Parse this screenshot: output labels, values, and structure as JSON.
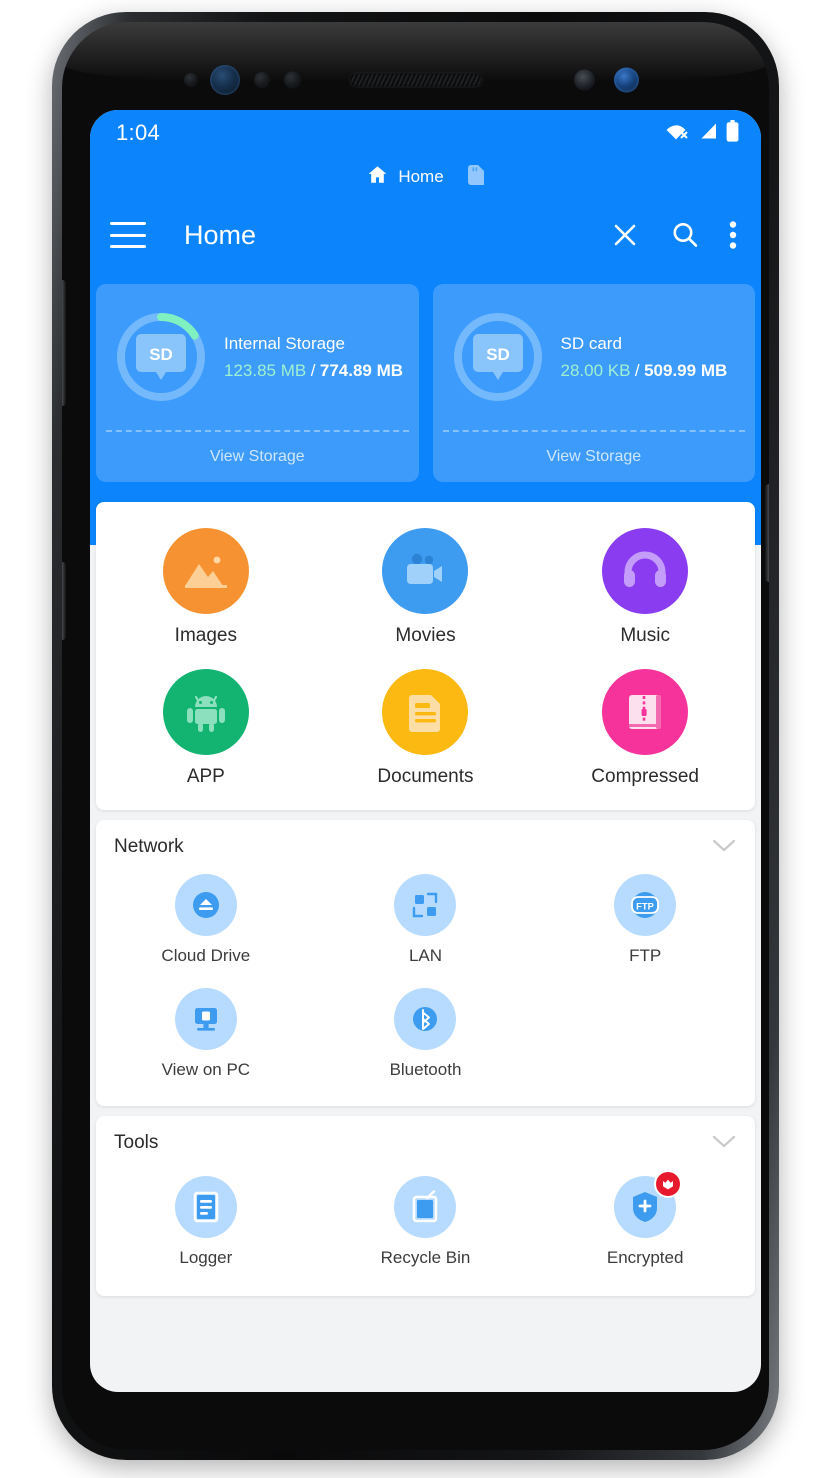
{
  "statusbar": {
    "time": "1:04",
    "icons": [
      "wifi-off-icon",
      "cellular-signal-icon",
      "battery-full-icon"
    ]
  },
  "breadcrumb": {
    "home_icon": "home-icon",
    "label": "Home",
    "sd_icon": "sd-card-icon"
  },
  "toolbar": {
    "menu_icon": "hamburger-menu-icon",
    "title": "Home",
    "close_label": "close-icon",
    "search_label": "search-icon",
    "overflow_label": "more-vertical-icon"
  },
  "storage": [
    {
      "name": "Internal Storage",
      "used": "123.85 MB",
      "separator": "/",
      "total": "774.89 MB",
      "percent": 16,
      "badge": "SD",
      "action": "View Storage",
      "ring_color": "#7ff0c0"
    },
    {
      "name": "SD card",
      "used": "28.00 KB",
      "separator": "/",
      "total": "509.99 MB",
      "percent": 0,
      "badge": "SD",
      "action": "View Storage",
      "ring_color": "#7ff0c0"
    }
  ],
  "categories": [
    {
      "label": "Images",
      "icon": "image-icon",
      "color": "#f79232"
    },
    {
      "label": "Movies",
      "icon": "video-icon",
      "color": "#3d9bf0"
    },
    {
      "label": "Music",
      "icon": "headphones-icon",
      "color": "#8a3df0"
    },
    {
      "label": "APP",
      "icon": "android-icon",
      "color": "#13b371"
    },
    {
      "label": "Documents",
      "icon": "document-icon",
      "color": "#fbb911"
    },
    {
      "label": "Compressed",
      "icon": "archive-icon",
      "color": "#f5339a"
    }
  ],
  "network": {
    "title": "Network",
    "collapse_icon": "chevron-down-icon",
    "items": [
      {
        "label": "Cloud Drive",
        "icon": "cloud-drive-icon"
      },
      {
        "label": "LAN",
        "icon": "lan-icon"
      },
      {
        "label": "FTP",
        "icon": "ftp-icon",
        "text": "FTP"
      },
      {
        "label": "View on PC",
        "icon": "monitor-icon"
      },
      {
        "label": "Bluetooth",
        "icon": "bluetooth-icon"
      }
    ]
  },
  "tools": {
    "title": "Tools",
    "collapse_icon": "chevron-down-icon",
    "items": [
      {
        "label": "Logger",
        "icon": "log-file-icon"
      },
      {
        "label": "Recycle Bin",
        "icon": "recycle-bin-icon"
      },
      {
        "label": "Encrypted",
        "icon": "shield-plus-icon",
        "badge": "vip-crown-badge"
      }
    ]
  },
  "theme": {
    "header_blue": "#0b84fc",
    "card_blue": "#3d9bfb",
    "accent_green": "#7ff0c0",
    "network_icon_bg": "#b7dbff",
    "badge_red": "#e8192c"
  }
}
